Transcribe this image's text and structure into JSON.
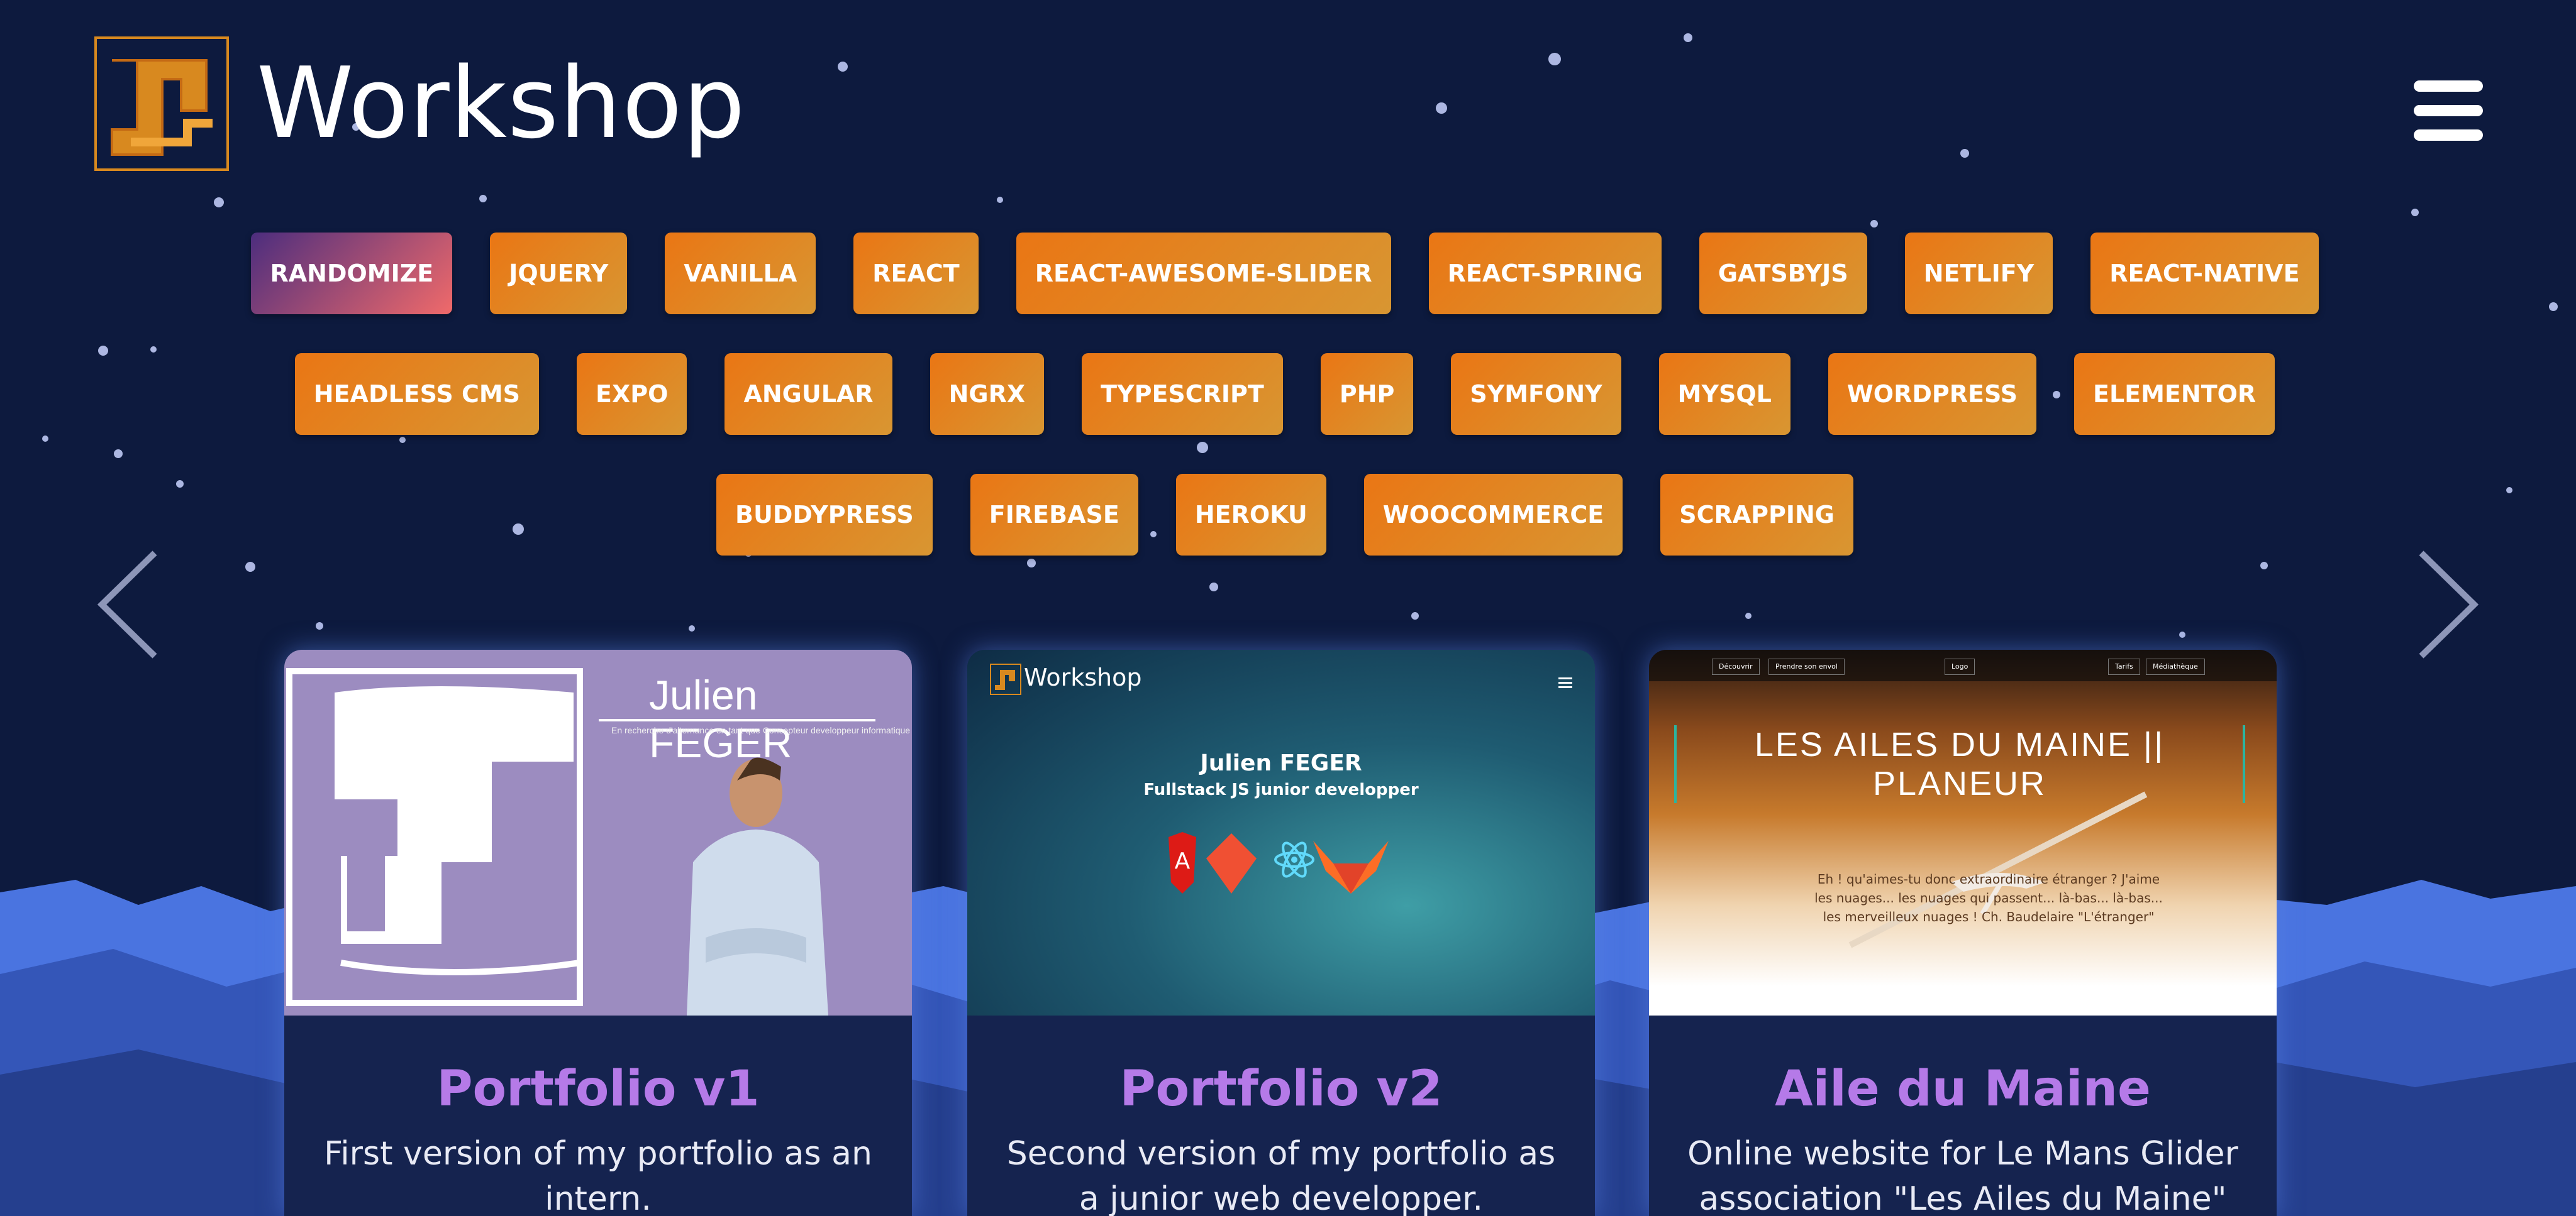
{
  "header": {
    "brand": "Workshop",
    "menu_icon": "hamburger-menu-icon",
    "logo_icon": "workshop-logo-icon"
  },
  "tags": {
    "row1": [
      "RANDOMIZE",
      "JQUERY",
      "VANILLA",
      "REACT",
      "REACT-AWESOME-SLIDER",
      "REACT-SPRING",
      "GATSBYJS",
      "NETLIFY",
      "REACT-NATIVE"
    ],
    "row2": [
      "HEADLESS CMS",
      "EXPO",
      "ANGULAR",
      "NGRX",
      "TYPESCRIPT",
      "PHP",
      "SYMFONY",
      "MYSQL",
      "WORDPRESS",
      "ELEMENTOR"
    ],
    "row3": [
      "BUDDYPRESS",
      "FIREBASE",
      "HEROKU",
      "WOOCOMMERCE",
      "SCRAPPING"
    ]
  },
  "carousel": {
    "prev_icon": "chevron-left-icon",
    "next_icon": "chevron-right-icon"
  },
  "projects": [
    {
      "title": "Portfolio v1",
      "description": "First version of my portfolio as an intern.",
      "thumb": {
        "name": "Julien FEGER",
        "subtitle": "En recherche d'alternance en tant que Concepteur developpeur informatique"
      }
    },
    {
      "title": "Portfolio v2",
      "description": "Second version of my portfolio as a junior web developper.",
      "thumb": {
        "brand": "Workshop",
        "name": "Julien FEGER",
        "role": "Fullstack JS junior developper"
      }
    },
    {
      "title": "Aile du Maine",
      "description": "Online website for Le Mans Glider association \"Les Ailes du Maine\"",
      "thumb": {
        "nav": [
          "Découvrir",
          "Prendre son envol",
          "Logo",
          "Tarifs",
          "Médiathèque"
        ],
        "site_title": "LES AILES DU MAINE || PLANEUR",
        "quote": "Eh ! qu'aimes-tu donc extraordinaire étranger ? J'aime les nuages... les nuages qui passent... là-bas... là-bas... les merveilleux nuages ! Ch. Baudelaire \"L'étranger\""
      }
    }
  ],
  "colors": {
    "background": "#0d1a3e",
    "tag_orange": "#ea7614",
    "randomize_start": "#4c2d7e",
    "randomize_end": "#f06a6a",
    "card_title": "#b57ae8",
    "card_bg": "#15234f",
    "mountain": "#3a5fd0"
  }
}
